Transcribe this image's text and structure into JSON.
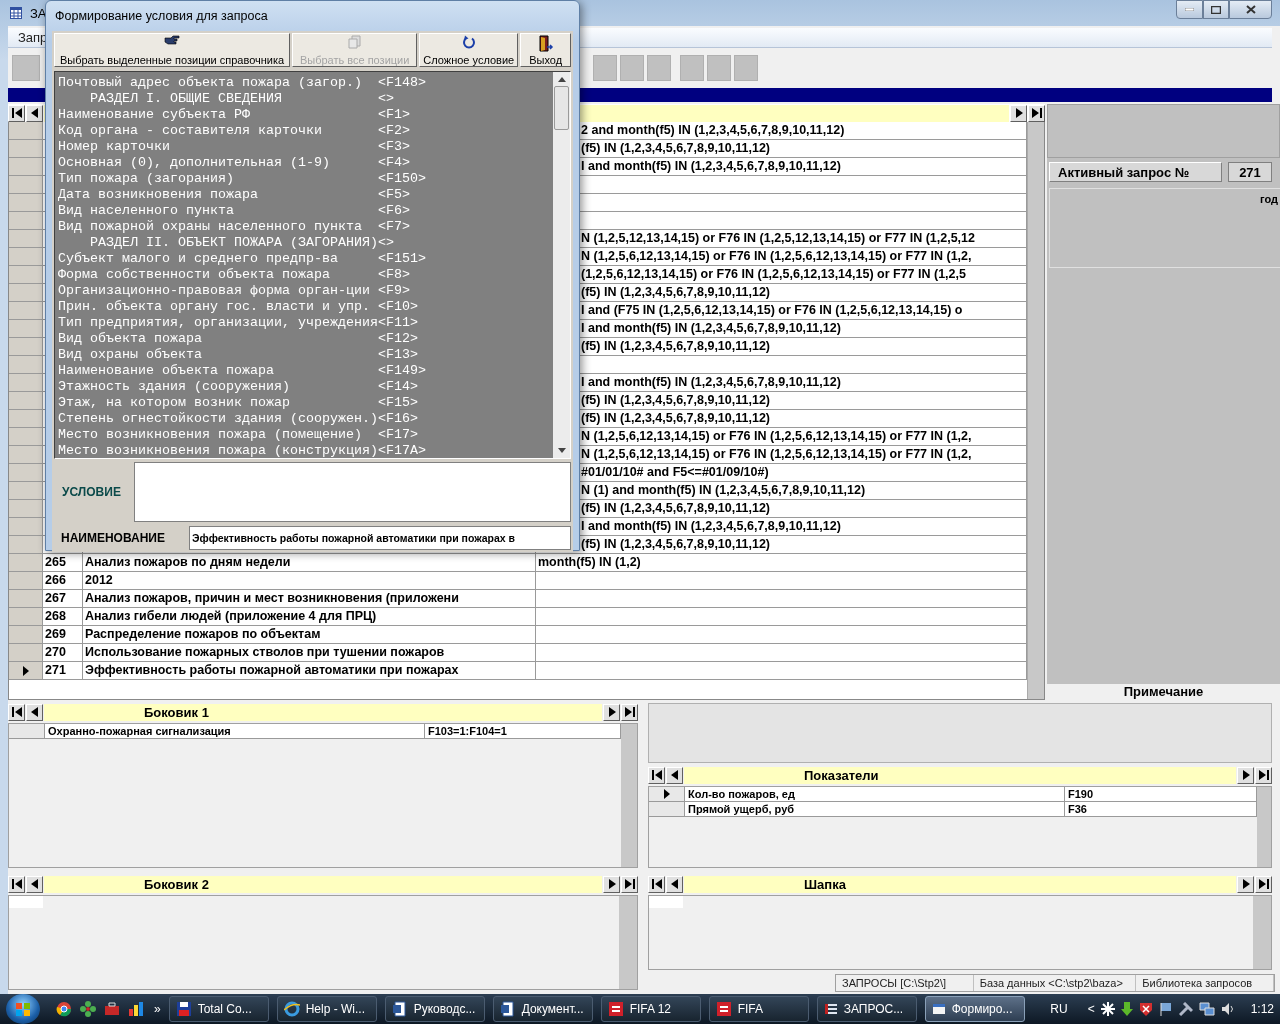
{
  "main_window": {
    "title": "ЗА",
    "menu": [
      "Запр"
    ],
    "grid": {
      "rows": [
        {
          "condition": "2 and month(f5) IN (1,2,3,4,5,6,7,8,9,10,11,12)",
          "current": false
        },
        {
          "condition": "(f5) IN (1,2,3,4,5,6,7,8,9,10,11,12)",
          "current": false
        },
        {
          "condition": "I and month(f5) IN (1,2,3,4,5,6,7,8,9,10,11,12)",
          "current": false
        },
        {
          "current": false
        },
        {
          "current": false
        },
        {
          "current": false
        },
        {
          "condition": "N (1,2,5,12,13,14,15) or F76 IN (1,2,5,12,13,14,15) or F77 IN (1,2,5,12",
          "current": false
        },
        {
          "condition": "N (1,2,5,6,12,13,14,15) or F76 IN (1,2,5,6,12,13,14,15) or F77 IN (1,2,",
          "current": false
        },
        {
          "condition": "(1,2,5,6,12,13,14,15) or F76 IN (1,2,5,6,12,13,14,15) or F77 IN (1,2,5",
          "current": false
        },
        {
          "condition": "(f5) IN (1,2,3,4,5,6,7,8,9,10,11,12)",
          "current": false
        },
        {
          "condition": "I and (F75 IN (1,2,5,6,12,13,14,15) or F76 IN (1,2,5,6,12,13,14,15) o",
          "current": false
        },
        {
          "condition": "I and month(f5) IN (1,2,3,4,5,6,7,8,9,10,11,12)",
          "current": false
        },
        {
          "condition": "(f5) IN (1,2,3,4,5,6,7,8,9,10,11,12)",
          "current": false
        },
        {
          "current": false
        },
        {
          "condition": "I and month(f5) IN (1,2,3,4,5,6,7,8,9,10,11,12)",
          "current": false
        },
        {
          "condition": "(f5) IN (1,2,3,4,5,6,7,8,9,10,11,12)",
          "current": false
        },
        {
          "condition": "(f5) IN (1,2,3,4,5,6,7,8,9,10,11,12)",
          "current": false
        },
        {
          "condition": "N (1,2,5,6,12,13,14,15) or F76 IN (1,2,5,6,12,13,14,15) or F77 IN (1,2,",
          "current": false
        },
        {
          "condition": "N (1,2,5,6,12,13,14,15) or F76 IN (1,2,5,6,12,13,14,15) or F77 IN (1,2,",
          "current": false
        },
        {
          "condition": "#01/01/10# and F5<=#01/09/10#)",
          "current": false
        },
        {
          "condition": "N (1) and month(f5) IN (1,2,3,4,5,6,7,8,9,10,11,12)",
          "current": false
        },
        {
          "condition": "(f5) IN (1,2,3,4,5,6,7,8,9,10,11,12)",
          "current": false
        },
        {
          "condition": "I and month(f5) IN (1,2,3,4,5,6,7,8,9,10,11,12)",
          "current": false
        },
        {
          "condition": "(f5) IN (1,2,3,4,5,6,7,8,9,10,11,12)",
          "current": false
        },
        {
          "number": "265",
          "name": "Анализ пожаров по дням недели",
          "condition": "month(f5) IN (1,2)",
          "current": false
        },
        {
          "number": "266",
          "name": "2012",
          "current": false
        },
        {
          "number": "267",
          "name": "Анализ пожаров, причин и мест возникновения (приложени",
          "current": false
        },
        {
          "number": "268",
          "name": "Анализ гибели людей (приложение 4 для ПРЦ)",
          "current": false
        },
        {
          "number": "269",
          "name": "Распределение пожаров по объектам",
          "current": false
        },
        {
          "number": "270",
          "name": "Использование пожарных стволов при тушении пожаров",
          "current": false
        },
        {
          "number": "271",
          "name": "Эффективность работы пожарной автоматики при пожарах",
          "current": true
        }
      ]
    },
    "active_query": {
      "label": "Активный запрос №",
      "value": "271"
    },
    "year_label": "год",
    "note_label": "Примечание",
    "side1": {
      "title": "Боковик 1",
      "rows": [
        {
          "name": "Охранно-пожарная сигнализация",
          "code": "F103=1:F104=1",
          "current": false
        }
      ]
    },
    "indicators": {
      "title": "Показатели",
      "rows": [
        {
          "name": "Кол-во пожаров, ед",
          "code": "F190",
          "current": true
        },
        {
          "name": "Прямой ущерб, руб",
          "code": "F36",
          "current": false
        }
      ]
    },
    "side2": {
      "title": "Боковик 2"
    },
    "header_panel": {
      "title": "Шапка"
    },
    "status_bar": [
      "ЗАПРОСЫ [C:\\Stp2\\]",
      "База данных <C:\\stp2\\baza>",
      "Библиотека запросов"
    ]
  },
  "dialog": {
    "title": "Формирование условия для запроса",
    "toolbar": [
      {
        "label": "Выбрать выделенные позиции справочника",
        "disabled": false
      },
      {
        "label": "Выбрать все позиции",
        "disabled": true
      },
      {
        "label": "Сложное условие",
        "disabled": false
      },
      {
        "label": "Выход",
        "disabled": false
      }
    ],
    "fields": [
      {
        "kind": "field",
        "label": "Почтовый адрес объекта пожара (загор.)",
        "code": "<F148>"
      },
      {
        "kind": "section",
        "label": "РАЗДЕЛ I. ОБЩИЕ СВЕДЕНИЯ",
        "code": "<>"
      },
      {
        "kind": "field",
        "label": "Наименование субъекта РФ",
        "code": "<F1>"
      },
      {
        "kind": "field",
        "label": "Код органа - составителя карточки",
        "code": "<F2>"
      },
      {
        "kind": "field",
        "label": "Номер карточки",
        "code": "<F3>"
      },
      {
        "kind": "field",
        "label": "Основная (0), дополнительная (1-9)",
        "code": "<F4>"
      },
      {
        "kind": "field",
        "label": "Тип пожара (загорания)",
        "code": "<F150>"
      },
      {
        "kind": "field",
        "label": "Дата возникновения пожара",
        "code": "<F5>"
      },
      {
        "kind": "field",
        "label": "Вид населенного пункта",
        "code": "<F6>"
      },
      {
        "kind": "field",
        "label": "Вид пожарной охраны населенного пункта",
        "code": "<F7>"
      },
      {
        "kind": "section",
        "label": "РАЗДЕЛ II. ОБЪЕКТ ПОЖАРА (ЗАГОРАНИЯ)",
        "code": "<>"
      },
      {
        "kind": "field",
        "label": "Субъект малого и среднего предпр-ва",
        "code": "<F151>"
      },
      {
        "kind": "field",
        "label": "Форма собственности объекта пожара",
        "code": "<F8>"
      },
      {
        "kind": "field",
        "label": "Организационно-правовая форма орган-ции",
        "code": "<F9>"
      },
      {
        "kind": "field",
        "label": "Прин. объекта органу гос. власти и упр.",
        "code": "<F10>"
      },
      {
        "kind": "field",
        "label": "Тип предприятия, организации, учреждения",
        "code": "<F11>"
      },
      {
        "kind": "field",
        "label": "Вид объекта пожара",
        "code": "<F12>"
      },
      {
        "kind": "field",
        "label": "Вид охраны объекта",
        "code": "<F13>"
      },
      {
        "kind": "field",
        "label": "Наименование объекта пожара",
        "code": "<F149>"
      },
      {
        "kind": "field",
        "label": "Этажность здания (сооружения)",
        "code": "<F14>"
      },
      {
        "kind": "field",
        "label": "Этаж, на котором возник пожар",
        "code": "<F15>"
      },
      {
        "kind": "field",
        "label": "Степень огнестойкости здания (сооружен.)",
        "code": "<F16>"
      },
      {
        "kind": "field",
        "label": "Место возникновения пожара (помещение)",
        "code": "<F17>"
      },
      {
        "kind": "field",
        "label": "Место возникновения пожара (конструкция)",
        "code": "<F17A>"
      }
    ],
    "condition_label": "УСЛОВИЕ",
    "name_label": "НАИМЕНОВАНИЕ",
    "name_value": "Эффективность работы пожарной автоматики при пожарах в"
  },
  "taskbar": {
    "quick_launch_more": "»",
    "tasks": [
      {
        "kind": "files",
        "label": "Total Co...",
        "selected": false
      },
      {
        "kind": "browser",
        "label": "Help - Wi...",
        "selected": false
      },
      {
        "kind": "word",
        "label": "Руководс...",
        "selected": false
      },
      {
        "kind": "word",
        "label": "Документ...",
        "selected": false
      },
      {
        "kind": "game",
        "label": "FIFA 12",
        "selected": false
      },
      {
        "kind": "game",
        "label": "FIFA",
        "selected": false
      },
      {
        "kind": "app",
        "label": "ЗАПРОС...",
        "selected": false
      },
      {
        "kind": "window",
        "label": "Формиро...",
        "selected": true
      }
    ],
    "language": "RU",
    "tray_expand": "<",
    "clock": "1:12"
  }
}
